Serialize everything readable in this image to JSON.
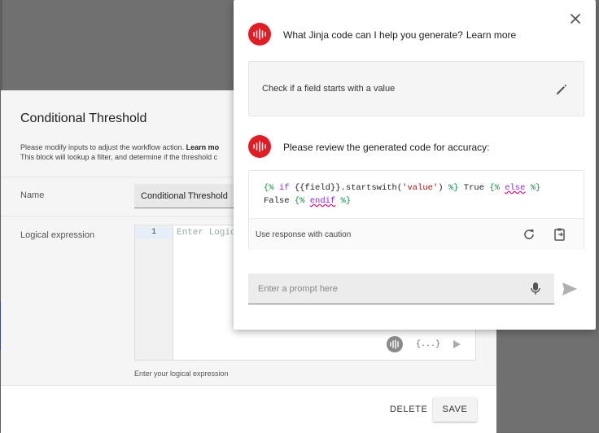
{
  "dialog": {
    "title": "Conditional Threshold",
    "desc_line1": "Please modify inputs to adjust the workflow action.",
    "desc_learn": "Learn mo",
    "desc_line2": "This block will lookup a filter, and determine if the threshold c",
    "name_label": "Name",
    "name_value": "Conditional Threshold",
    "logic_label": "Logical expression",
    "editor_line_number": "1",
    "editor_placeholder": "Enter Logic",
    "braces_label": "{...}",
    "helper_text": "Enter your logical expression",
    "delete_label": "DELETE",
    "save_label": "SAVE"
  },
  "assistant": {
    "question": "What Jinja code can I help you generate?",
    "learn_more": "Learn more",
    "prompt": "Check if a field starts with a value",
    "review": "Please review the generated code for accuracy:",
    "code_line1_parts": [
      "{% ",
      "if ",
      "{{field}}",
      ".startswith(",
      "'value'",
      ") ",
      "%}",
      " True ",
      "{% ",
      "else",
      " %}"
    ],
    "code_line2_parts": [
      "False ",
      "{% ",
      "endif",
      " %}"
    ],
    "caution": "Use response with caution",
    "input_placeholder": "Enter a prompt here"
  },
  "colors": {
    "brand": "#e41b23",
    "backdrop": "#707070"
  },
  "icons": [
    "close-icon",
    "sound-wave-icon",
    "edit-icon",
    "refresh-icon",
    "clipboard-icon",
    "mic-icon",
    "send-icon",
    "play-icon"
  ]
}
